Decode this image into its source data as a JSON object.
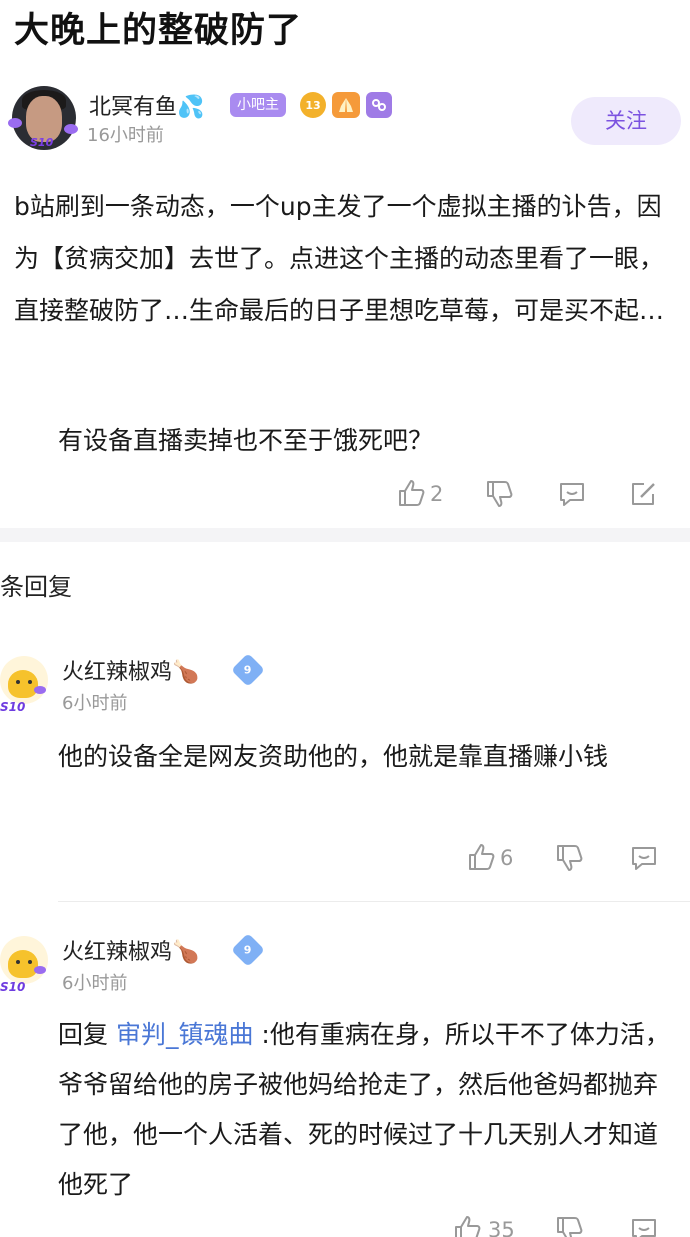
{
  "post": {
    "title": "大晚上的整破防了",
    "author": {
      "name": "北冥有鱼",
      "name_emoji": "💦",
      "role_tag": "小吧主",
      "level": "13",
      "time": "16小时前"
    },
    "follow_label": "关注",
    "content": "b站刷到一条动态，一个up主发了一个虚拟主播的讣告，因为【贫病交加】去世了。点进这个主播的动态里看了一眼，直接整破防了…生命最后的日子里想吃草莓，可是买不起…"
  },
  "top_reply": {
    "text": "有设备直播卖掉也不至于饿死吧？",
    "like_count": "2"
  },
  "replies_header": "条回复",
  "comments": [
    {
      "name": "火红辣椒鸡",
      "name_emoji": "🍗",
      "time": "6小时前",
      "text": "他的设备全是网友资助他的，他就是靠直播赚小钱",
      "like_count": "6"
    },
    {
      "name": "火红辣椒鸡",
      "name_emoji": "🍗",
      "time": "6小时前",
      "reply_prefix": "回复 ",
      "reply_target": "审判_镇魂曲",
      "reply_text": " :他有重病在身，所以干不了体力活，爷爷留给他的房子被他妈给抢走了，然后他爸妈都抛弃了他，他一个人活着、死的时候过了十几天别人才知道他死了",
      "like_count": "35"
    }
  ],
  "avatar_badge": "S10",
  "colors": {
    "accent": "#7b52e0",
    "tag_bg": "#a98bf0",
    "link": "#4a77d6",
    "muted": "#999999"
  }
}
